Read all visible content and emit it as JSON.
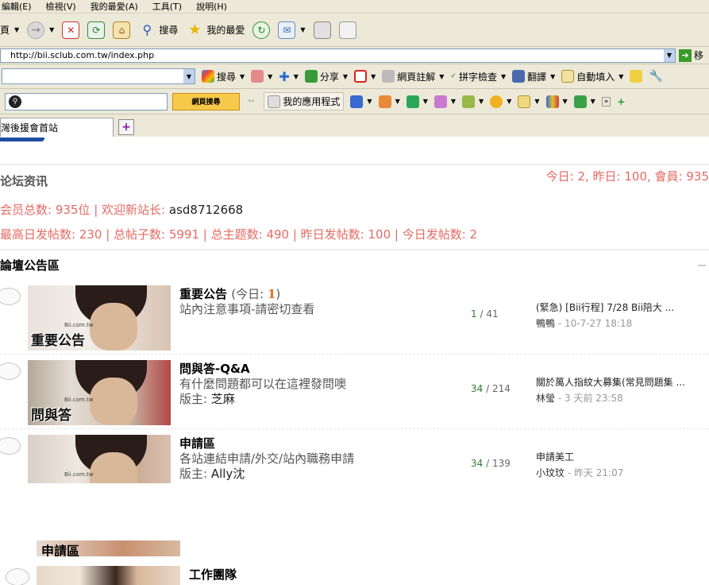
{
  "menu": [
    "編輯(E)",
    "檢視(V)",
    "我的最愛(A)",
    "工具(T)",
    "說明(H)"
  ],
  "toolbar": {
    "page_label": "頁",
    "search_label": "搜尋",
    "favorites_label": "我的最愛"
  },
  "address": {
    "url": "http://bii.sclub.com.tw/index.php",
    "go_label": "移"
  },
  "google_bar": {
    "search_label": "搜尋",
    "share_label": "分享",
    "annotate_label": "網頁註解",
    "spellcheck_label": "拼字檢查",
    "translate_label": "翻譯",
    "autofill_label": "自動填入"
  },
  "search_bar": {
    "button_label": "網頁搜尋",
    "apps_label": "我的應用程式"
  },
  "tab": {
    "title": "灣後援會首站"
  },
  "forum_info": {
    "title": "论坛资讯",
    "stats_right": "今日: 2, 昨日: 100, 會員: 935",
    "member_prefix": "会员总数: 935位 | 欢迎新站长: ",
    "new_admin": "asd8712668",
    "post_stats": "最高日发帖数: 230 | 总帖子数: 5991 | 总主题数: 490 | 昨日发帖数: 100 | 今日发帖数: 2"
  },
  "section": {
    "title": "論壇公告區"
  },
  "forums": [
    {
      "name": "重要公告",
      "today_prefix": "(今日: ",
      "today_count": "1",
      "today_suffix": ")",
      "desc": "站內注意事項-請密切查看",
      "mod_label": "",
      "mod": "",
      "threads": "1",
      "posts": " / 41",
      "thumb_text": "重要公告",
      "last_title": "(緊急) [Bii行程] 7/28 Bii陪大 ...",
      "last_user": "鴨鴨",
      "last_time": " - 10-7-27 18:18"
    },
    {
      "name": "問與答-Q&A",
      "desc": "有什麼問題都可以在這裡發問噢",
      "mod_label": "版主: ",
      "mod": "芝麻",
      "threads": "34",
      "posts": " / 214",
      "thumb_text": "問與答",
      "last_title": "關於萬人指紋大募集(常見問題集 ...",
      "last_user": "林瑩",
      "last_time": " - 3 天前 23:58"
    },
    {
      "name": "申請區",
      "desc": "各站連結申請/外交/站內職務申請",
      "mod_label": "版主: ",
      "mod": "Ally沈",
      "threads": "34",
      "posts": " / 139",
      "thumb_text": "申請區",
      "last_title": "申請美工",
      "last_user": "小玟玟",
      "last_time": " - 昨天 21:07"
    }
  ],
  "watermark": "Bii.com.tw",
  "extra_row": {
    "strip_text": "申請區",
    "name": "工作團隊"
  }
}
